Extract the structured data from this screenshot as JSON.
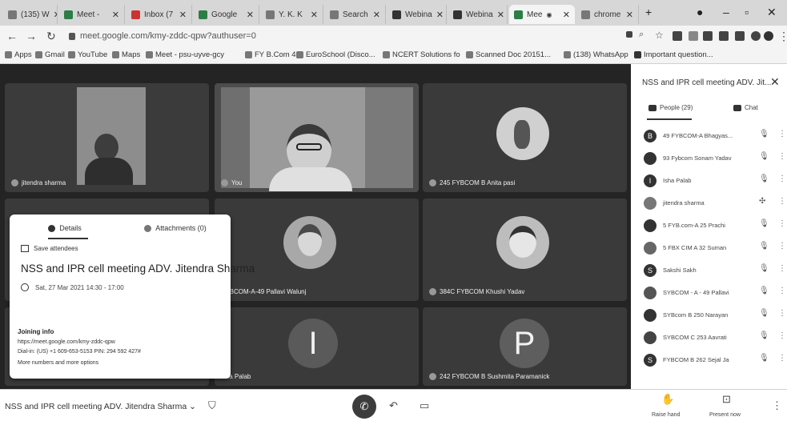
{
  "browser": {
    "tabs": [
      {
        "label": "(135) W"
      },
      {
        "label": "Meet -"
      },
      {
        "label": "Inbox (7"
      },
      {
        "label": "Google"
      },
      {
        "label": "Y. K. K"
      },
      {
        "label": "Search"
      },
      {
        "label": "Webina"
      },
      {
        "label": "Webina"
      },
      {
        "label": "Mee"
      },
      {
        "label": "chrome"
      }
    ],
    "new_tab": "+",
    "url": "meet.google.com/kmy-zddc-qpw?authuser=0",
    "bookmarks": [
      {
        "label": "Apps"
      },
      {
        "label": "Gmail"
      },
      {
        "label": "YouTube"
      },
      {
        "label": "Maps"
      },
      {
        "label": "Meet - psu-uyve-gcy"
      },
      {
        "label": "FY B.Com 4"
      },
      {
        "label": "EuroSchool (Disco..."
      },
      {
        "label": "NCERT Solutions fo"
      },
      {
        "label": "Scanned Doc 20151..."
      },
      {
        "label": "(138) WhatsApp"
      },
      {
        "label": "Important question..."
      }
    ]
  },
  "tiles": {
    "t1": {
      "name": "jitendra sharma"
    },
    "t2": {
      "name": "You"
    },
    "t3": {
      "name": "245 FYBCOM B Anita pasi"
    },
    "t5": {
      "name": "SYBCOM-A-49 Pallavi Walunj"
    },
    "t6": {
      "name": "384C FYBCOM Khushi Yadav"
    },
    "t8": {
      "name": "isha Palab",
      "letter": "I"
    },
    "t9": {
      "name": "242 FYBCOM B Sushmita Paramanick",
      "letter": "P"
    }
  },
  "details": {
    "tab_details": "Details",
    "tab_attachments": "Attachments (0)",
    "save_attendees": "Save attendees",
    "title": "NSS and IPR cell meeting ADV. Jitendra Sharma",
    "datetime": "Sat, 27 Mar 2021 14:30 - 17:00",
    "joining_heading": "Joining info",
    "join_url": "https://meet.google.com/kmy-zddc-qpw",
    "dial_in": "Dial-in: (US) +1 609-653-5153 PIN: 294 592 427#",
    "more_numbers": "More numbers and more options"
  },
  "bottom": {
    "meeting_name": "NSS and IPR cell meeting ADV. Jitendra Sharma",
    "raise_hand": "Raise hand",
    "present_now": "Present now"
  },
  "panel": {
    "title": "NSS and IPR cell meeting ADV. Jit...",
    "tab_people": "People (29)",
    "tab_chat": "Chat",
    "participants": [
      {
        "name": "49 FYBCOM-A Bhagyas..."
      },
      {
        "name": "93 Fybcom Sonam Yadav"
      },
      {
        "name": "Isha Palab"
      },
      {
        "name": "jitendra sharma"
      },
      {
        "name": "5 FYB.com-A 25 Prachi"
      },
      {
        "name": "5 FBX CIM A 32 Suman"
      },
      {
        "name": "Sakshi Sakh"
      },
      {
        "name": "SYBCOM - A - 49 Pallavi"
      },
      {
        "name": "SYBcom B 250 Narayan"
      },
      {
        "name": "SYBCOM C 253 Aavrati"
      },
      {
        "name": "FYBCOM B 262 Sejal Ja"
      }
    ]
  }
}
